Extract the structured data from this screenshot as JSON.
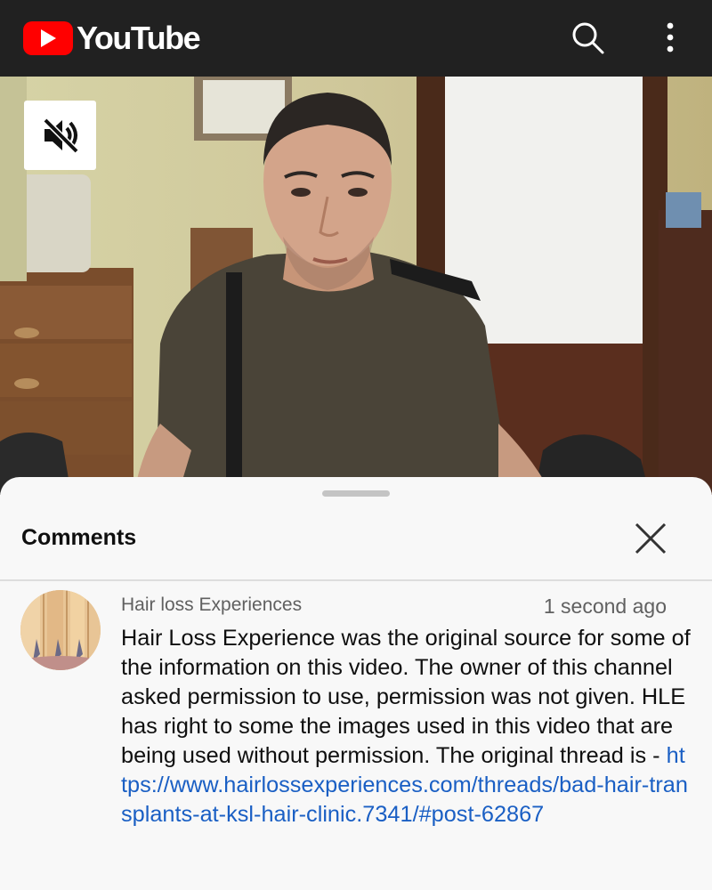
{
  "app": {
    "logo_text": "YouTube",
    "brand_color": "#ff0000",
    "icons": {
      "search": "search-icon",
      "more": "more-vert-icon",
      "mute": "volume-off-icon",
      "close": "close-icon"
    }
  },
  "comments_panel": {
    "title": "Comments"
  },
  "comment": {
    "author": "Hair loss Experiences",
    "time": "1 second ago",
    "text": "Hair Loss Experience was the original source for some of the information on this video. The owner of this channel asked permission to use, permission was not given. HLE has right to some the images used in this video that are being used without permission. The original thread is -",
    "link": "https://www.hairlossexperiences.com/threads/bad-hair-transplants-at-ksl-hair-clinic.7341/#post-62867",
    "link_color": "#1a5fc4"
  }
}
